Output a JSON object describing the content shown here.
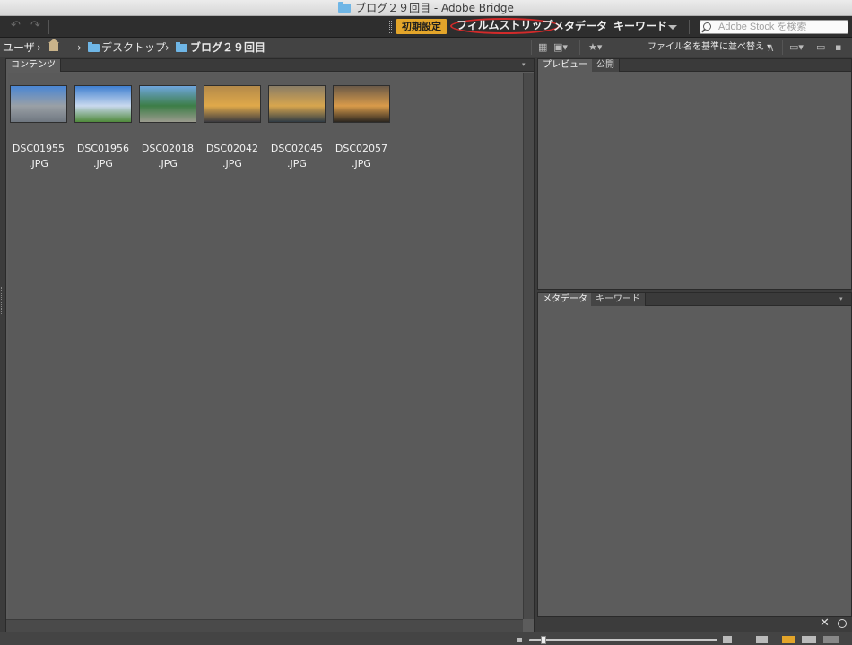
{
  "window": {
    "title": "ブログ２９回目 - Adobe Bridge"
  },
  "workspace": {
    "active": "初期設定",
    "items": [
      "フィルムストリップ",
      "メタデータ",
      "キーワード"
    ],
    "search_placeholder": "Adobe Stock を検索"
  },
  "path": {
    "crumbs": [
      "ユーザ",
      "デスクトップ",
      "ブログ２９回目"
    ]
  },
  "sort": {
    "label": "ファイル名を基準に並べ替え"
  },
  "content_panel": {
    "tab": "コンテンツ",
    "thumbnails": [
      {
        "name": "DSC01955",
        "ext": ".JPG",
        "colors": [
          "#4a86d4",
          "#9aa0a6",
          "#6f7780"
        ]
      },
      {
        "name": "DSC01956",
        "ext": ".JPG",
        "colors": [
          "#3f7fd0",
          "#c9d9ee",
          "#4f8a3a"
        ]
      },
      {
        "name": "DSC02018",
        "ext": ".JPG",
        "colors": [
          "#6fa6dd",
          "#3c7d46",
          "#9b9b8e"
        ]
      },
      {
        "name": "DSC02042",
        "ext": ".JPG",
        "colors": [
          "#b48a4a",
          "#e0a94a",
          "#3a3a40"
        ]
      },
      {
        "name": "DSC02045",
        "ext": ".JPG",
        "colors": [
          "#8a7d66",
          "#d8a64e",
          "#2f3b45"
        ]
      },
      {
        "name": "DSC02057",
        "ext": ".JPG",
        "colors": [
          "#6a5a48",
          "#d99b4a",
          "#2b2620"
        ]
      }
    ]
  },
  "preview_panel": {
    "tabs": [
      "プレビュー",
      "公開"
    ]
  },
  "metadata_panel": {
    "tabs": [
      "メタデータ",
      "キーワード"
    ]
  }
}
